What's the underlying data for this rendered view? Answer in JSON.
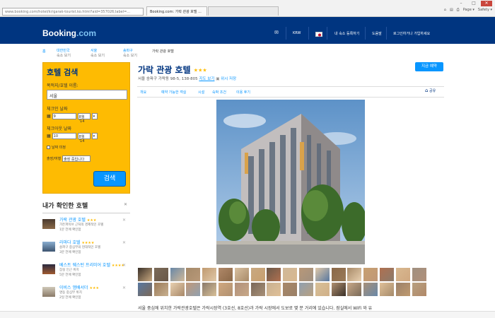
{
  "browser": {
    "address": "www.booking.com/hotel/kr/garak-tourist.ko.html?aid=357026;label=...",
    "tab_active": "Booking.com: 가락 관광 호텔 ...",
    "tools": [
      "Page ▾",
      "Safety ▾"
    ]
  },
  "header": {
    "logo_main": "Booking",
    "logo_tld": ".com",
    "currency": "KRW",
    "nav": [
      "내 숙소 등록하기",
      "도움말",
      "로그인하거나 가입하세요"
    ]
  },
  "breadcrumb": {
    "items": [
      "홈",
      "대한민국\n숙소 보기",
      "서울\n숙소 보기",
      "송파구\n숙소 보기"
    ],
    "current": "가락 관광 호텔"
  },
  "search": {
    "title": "호텔 검색",
    "dest_label": "목적지/호텔 이름:",
    "dest_value": "서울",
    "checkin_label": "체크인 날짜",
    "checkin_day": "9",
    "checkin_month": "8월 '14",
    "checkout_label": "체크아웃 날짜",
    "checkout_day": "10",
    "checkout_month": "8월 '14",
    "flexible_label": "날짜 미정",
    "purpose_label": "출장/여행",
    "purpose_value": "출장 중입니다",
    "submit": "검색"
  },
  "recent": {
    "title": "내가 확인한 호텔",
    "items": [
      {
        "name": "가락 관광 호텔",
        "stars": "★★★",
        "line1": "가든파이브 근처의 경제적인 호텔",
        "line2": "1분 전에 확인함"
      },
      {
        "name": "라마다 호텔",
        "stars": "★★★★",
        "line1": "송파구 중심부의 현대적인 호텔",
        "line2": "3분 전에 확인함"
      },
      {
        "name": "베스트 웨스턴 프리미어 호텔",
        "stars": "★★★★",
        "line1": "잠실 인근 위치",
        "line2": "5분 전에 확인함"
      },
      {
        "name": "이비스 앰배서더",
        "stars": "★★★",
        "line1": "명동 중심부 위치",
        "line2": "2일 전에 확인함"
      }
    ]
  },
  "hotel": {
    "name": "가락 관광 호텔",
    "stars": "★★★",
    "address": "서울 송파구 가락동 98-5, 138-805",
    "map_link": "지도 보기",
    "save": "위시 저장",
    "book_now": "지금 예약",
    "tabs": [
      "개요",
      "예약 가능한 객실",
      "시설",
      "숙박 조건",
      "이용 후기"
    ],
    "share": "공유"
  },
  "description": "서울 중심에 위치한 가락관광호텔은 가락시장역 (3호선, 8호선)과 가락 시장에서 도보로 몇 분 거리에 있습니다. 잠실에서 WiFi 와 유"
}
